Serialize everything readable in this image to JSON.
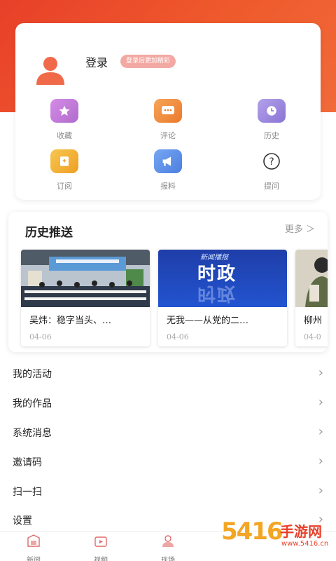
{
  "profile": {
    "login_label": "登录",
    "login_hint": "登录后更加精彩",
    "functions": [
      {
        "label": "收藏",
        "icon": "star-icon",
        "color": "#c37ad7"
      },
      {
        "label": "评论",
        "icon": "comment-icon",
        "color": "#f08a3c"
      },
      {
        "label": "历史",
        "icon": "clock-icon",
        "color": "#9b86dc"
      },
      {
        "label": "订阅",
        "icon": "subscribe-icon",
        "color": "#f2b33b"
      },
      {
        "label": "报料",
        "icon": "megaphone-icon",
        "color": "#5b8fe9"
      },
      {
        "label": "提问",
        "icon": "question-icon",
        "color": "#333333"
      }
    ]
  },
  "history": {
    "title": "历史推送",
    "more": "更多 ＞",
    "items": [
      {
        "title": "吴炜：稳字当头、…",
        "date": "04-06"
      },
      {
        "title": "无我——从党的二…",
        "date": "04-06",
        "image_text": "时政",
        "image_caption": "新闻播报"
      },
      {
        "title": "柳州",
        "date": "04-0"
      }
    ]
  },
  "menu": [
    {
      "label": "我的活动"
    },
    {
      "label": "我的作品"
    },
    {
      "label": "系统消息"
    },
    {
      "label": "邀请码"
    },
    {
      "label": "扫一扫"
    },
    {
      "label": "设置"
    }
  ],
  "tabbar": {
    "items": [
      {
        "label": "新闻"
      },
      {
        "label": "视频"
      },
      {
        "label": "现场"
      }
    ]
  },
  "watermark": {
    "digits": "5416",
    "text": "手游网",
    "url": "www.5416.cn"
  },
  "colors": {
    "brand": "#e8402a",
    "accent_pink": "#f3a9a3"
  }
}
